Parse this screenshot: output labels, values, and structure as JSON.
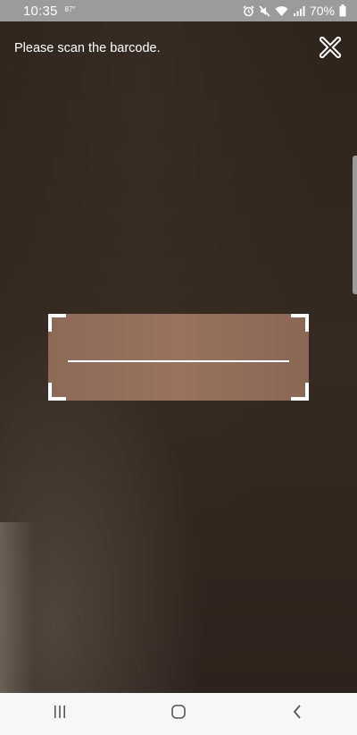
{
  "status_bar": {
    "time": "10:35",
    "temperature": "87°",
    "battery_percent": "70%",
    "icons": [
      "alarm-icon",
      "mute-icon",
      "wifi-icon",
      "signal-icon",
      "battery-icon"
    ]
  },
  "scanner": {
    "instruction": "Please scan the barcode.",
    "close_icon": "close-x-icon"
  },
  "nav_bar": {
    "buttons": [
      "recent-apps-icon",
      "home-icon",
      "back-icon"
    ]
  },
  "colors": {
    "status_bar_bg": "#9b9b9b",
    "camera_bg": "#2d241d",
    "scan_area": "#93705d",
    "nav_bar_bg": "#f7f7f7",
    "frame": "#ffffff"
  }
}
